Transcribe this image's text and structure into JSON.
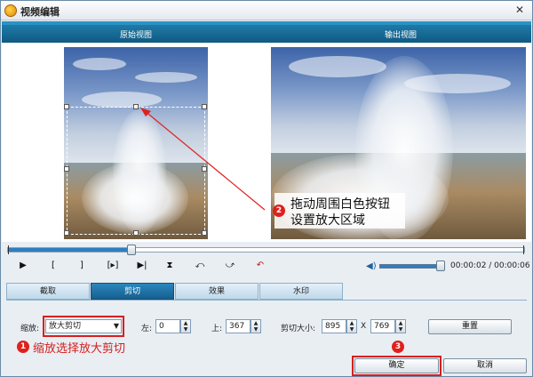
{
  "window": {
    "title": "视频编辑",
    "close_glyph": "✕"
  },
  "views": {
    "original_label": "原始视图",
    "output_label": "输出视图"
  },
  "annotations": {
    "step1": {
      "badge": "1",
      "text": "缩放选择放大剪切"
    },
    "step2": {
      "badge": "2",
      "line1": "拖动周围白色按钮",
      "line2": "设置放大区域"
    },
    "step3": {
      "badge": "3"
    },
    "color": "#e0201c"
  },
  "playback": {
    "progress_fraction": 0.24,
    "volume_fraction": 1.0,
    "time": "00:00:02 / 00:00:06",
    "controls": [
      {
        "name": "play-icon",
        "glyph": "▶"
      },
      {
        "name": "mark-in-icon",
        "glyph": "["
      },
      {
        "name": "mark-out-icon",
        "glyph": "]"
      },
      {
        "name": "frame-step-icon",
        "glyph": "[▸]"
      },
      {
        "name": "skip-end-icon",
        "glyph": "▶|"
      },
      {
        "name": "split-icon",
        "glyph": "⧗"
      },
      {
        "name": "rotate-left-icon",
        "glyph": "⤺"
      },
      {
        "name": "rotate-right-icon",
        "glyph": "⤻"
      },
      {
        "name": "undo-icon",
        "glyph": "↶"
      }
    ]
  },
  "tabs": [
    {
      "label": "截取",
      "active": false
    },
    {
      "label": "剪切",
      "active": true
    },
    {
      "label": "效果",
      "active": false
    },
    {
      "label": "水印",
      "active": false
    }
  ],
  "crop": {
    "zoom_label": "缩放:",
    "zoom_value": "放大剪切",
    "left_label": "左:",
    "left_value": "0",
    "top_label": "上:",
    "top_value": "367",
    "size_label": "剪切大小:",
    "width_value": "895",
    "times": "X",
    "height_value": "769",
    "reset_label": "重置"
  },
  "buttons": {
    "ok": "确定",
    "cancel": "取消"
  },
  "colors": {
    "accent": "#1a6f9e",
    "highlight": "#d62020"
  }
}
